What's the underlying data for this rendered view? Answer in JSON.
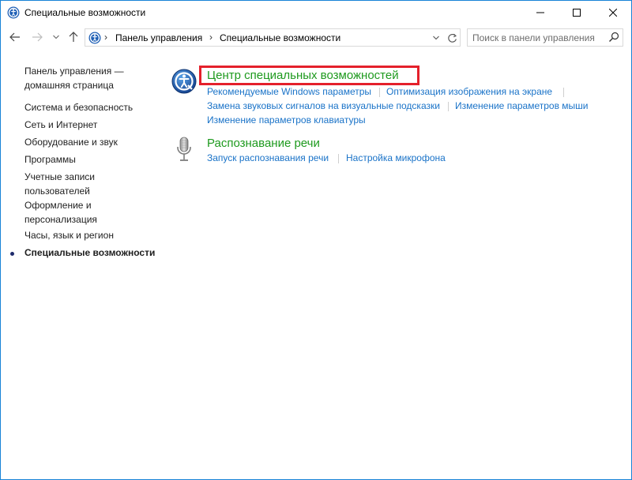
{
  "window": {
    "title": "Специальные возможности"
  },
  "navbar": {
    "breadcrumbs": [
      "Панель управления",
      "Специальные возможности"
    ],
    "search_placeholder": "Поиск в панели управления"
  },
  "left_pane": {
    "home_link_line1": "Панель управления —",
    "home_link_line2": "домашняя страница",
    "items": [
      {
        "label": "Система и безопасность"
      },
      {
        "label": "Сеть и Интернет"
      },
      {
        "label": "Оборудование и звук"
      },
      {
        "label": "Программы"
      },
      {
        "label_line1": "Учетные записи",
        "label_line2": "пользователей"
      },
      {
        "label_line1": "Оформление и",
        "label_line2": "персонализация"
      },
      {
        "label": "Часы, язык и регион"
      },
      {
        "label": "Специальные возможности",
        "current": true
      }
    ]
  },
  "sections": [
    {
      "title": "Центр специальных возможностей",
      "highlighted": true,
      "icon": "ease-of-access-icon",
      "links": [
        "Рекомендуемые Windows параметры",
        "Оптимизация изображения на экране",
        "Замена звуковых сигналов на визуальные подсказки",
        "Изменение параметров мыши",
        "Изменение параметров клавиатуры"
      ]
    },
    {
      "title": "Распознавание речи",
      "highlighted": false,
      "icon": "microphone-icon",
      "links": [
        "Запуск распознавания речи",
        "Настройка микрофона"
      ]
    }
  ],
  "colors": {
    "accent": "#1883d7",
    "section_title": "#1e9a1e",
    "link": "#1a73c8",
    "highlight_border": "#e4202b"
  }
}
